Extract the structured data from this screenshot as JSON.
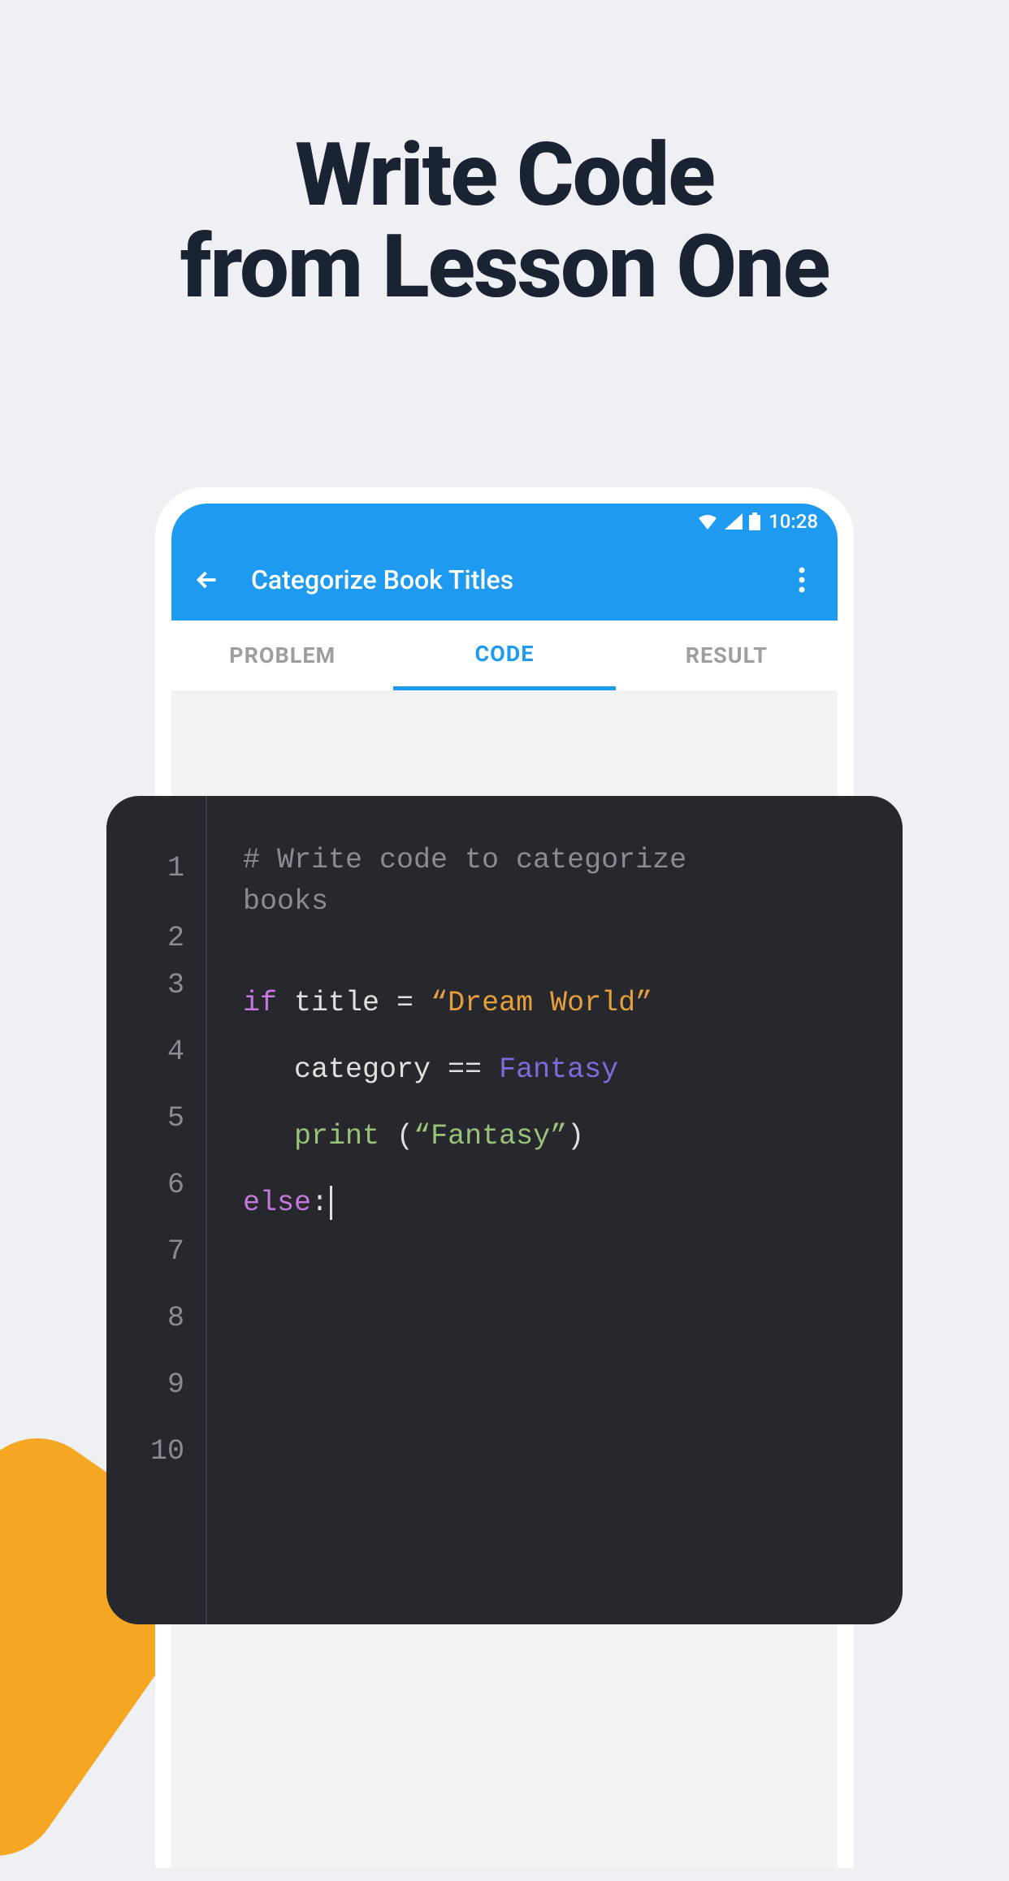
{
  "headline": {
    "line1": "Write Code",
    "line2": "from Lesson One"
  },
  "statusBar": {
    "time": "10:28"
  },
  "appBar": {
    "title": "Categorize Book Titles"
  },
  "tabs": {
    "problem": "PROBLEM",
    "code": "CODE",
    "result": "RESULT"
  },
  "editor": {
    "lineNumbers": [
      "1",
      "2",
      "3",
      "4",
      "5",
      "6",
      "7",
      "8",
      "9",
      "10"
    ],
    "code": {
      "line1_comment": "# Write code to categorize",
      "line1_comment_cont": "books",
      "line3_if": "if",
      "line3_var": " title ",
      "line3_op": "=",
      "line3_str": " “Dream World”",
      "line4_indent": "   ",
      "line4_var": "category ",
      "line4_op": "==",
      "line4_val": " Fantasy",
      "line5_indent": "   ",
      "line5_func": "print",
      "line5_paren": " (",
      "line5_str": "“Fantasy”",
      "line5_close": ")",
      "line6_else": "else",
      "line6_colon": ":"
    }
  }
}
